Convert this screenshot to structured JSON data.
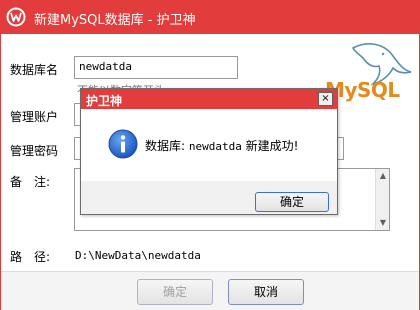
{
  "window": {
    "title": "新建MySQL数据库 - 护卫神",
    "colors": {
      "titlebar": "#e23c3c",
      "background": "#ffffff"
    },
    "app_icon": "huweishen-shield-icon"
  },
  "form": {
    "dbname_label": "数据库名",
    "dbname_value": "newdatda",
    "dbname_hint_partial": "不能以数字等开头",
    "account_label": "管理账户",
    "password_label": "管理密码",
    "note_label": "备　注:",
    "path_label": "路　径:",
    "path_value": "D:\\NewData\\newdatda",
    "mysql_logo_text": "MySQL",
    "mysql_logo_icon": "mysql-dolphin-icon"
  },
  "footer": {
    "ok_label": "确定",
    "cancel_label": "取消"
  },
  "dialog": {
    "title": "护卫神",
    "close_label": "×",
    "icon": "info-icon",
    "message_prefix": "数据库: ",
    "message_db": "newdatda",
    "message_suffix": " 新建成功!",
    "ok_label": "确定"
  }
}
